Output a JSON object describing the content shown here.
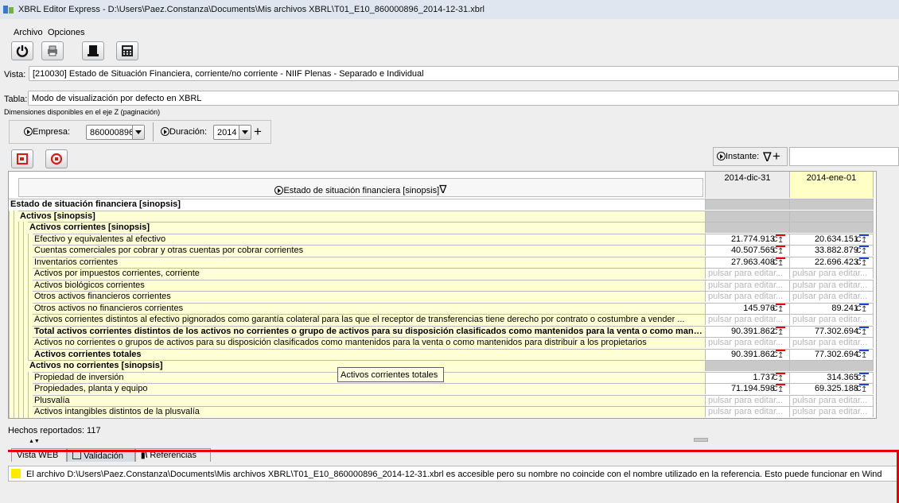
{
  "window": {
    "title": "XBRL Editor Express - D:\\Users\\Paez.Constanza\\Documents\\Mis archivos XBRL\\T01_E10_860000896_2014-12-31.xbrl"
  },
  "menu": {
    "archivo": "Archivo",
    "opciones": "Opciones"
  },
  "vista": {
    "label": "Vista:",
    "value": "[210030] Estado de Situación Financiera, corriente/no corriente - NIIF Plenas - Separado e Individual"
  },
  "tabla": {
    "label": "Tabla:",
    "value": "Modo de visualización por defecto en XBRL"
  },
  "dimensions": {
    "heading": "Dimensiones disponibles en el eje Z (paginación)",
    "empresa_label": "Empresa:",
    "empresa_value": "860000896",
    "duracion_label": "Duración:",
    "duracion_value": "2014"
  },
  "table": {
    "axis_label": "Estado de situación financiera [sinopsis]",
    "instante_label": "Instante:",
    "col1": "2014-dic-31",
    "col2": "2014-ene-01",
    "placeholder": "pulsar para editar...",
    "rows": [
      {
        "label": "Estado de situación financiera [sinopsis]",
        "v1": "",
        "v2": ""
      },
      {
        "label": "Activos [sinopsis]",
        "v1": "",
        "v2": ""
      },
      {
        "label": "Activos corrientes [sinopsis]",
        "v1": "",
        "v2": ""
      },
      {
        "label": "Efectivo y equivalentes al efectivo",
        "v1": "21.774.913",
        "v2": "20.634.151"
      },
      {
        "label": "Cuentas comerciales por cobrar y otras cuentas por cobrar corrientes",
        "v1": "40.507.565",
        "v2": "33.882.879"
      },
      {
        "label": "Inventarios corrientes",
        "v1": "27.963.408",
        "v2": "22.696.423"
      },
      {
        "label": "Activos por impuestos corrientes, corriente",
        "v1": "",
        "v2": ""
      },
      {
        "label": "Activos biológicos corrientes",
        "v1": "",
        "v2": ""
      },
      {
        "label": "Otros activos financieros corrientes",
        "v1": "",
        "v2": ""
      },
      {
        "label": "Otros activos no financieros corrientes",
        "v1": "145.976",
        "v2": "89.241"
      },
      {
        "label": "Activos corrientes distintos al efectivo pignorados como garantía colateral para las que el receptor de transferencias tiene derecho por contrato o costumbre a vender ...",
        "v1": "",
        "v2": ""
      },
      {
        "label": "Total activos corrientes distintos de los activos no corrientes o grupo de activos para su disposición clasificados como mantenidos para la venta o como mante...",
        "v1": "90.391.862",
        "v2": "77.302.694"
      },
      {
        "label": "Activos no corrientes o grupos de activos para su disposición clasificados como mantenidos para la venta o como mantenidos para distribuir a los propietarios",
        "v1": "",
        "v2": ""
      },
      {
        "label": "Activos corrientes totales",
        "v1": "90.391.862",
        "v2": "77.302.694"
      },
      {
        "label": "Activos no corrientes [sinopsis]",
        "v1": "",
        "v2": ""
      },
      {
        "label": "Propiedad de inversión",
        "v1": "1.737",
        "v2": "314.365"
      },
      {
        "label": "Propiedades, planta y equipo",
        "v1": "71.194.598",
        "v2": "69.325.188"
      },
      {
        "label": "Plusvalía",
        "v1": "",
        "v2": ""
      },
      {
        "label": "Activos intangibles distintos de la plusvalía",
        "v1": "",
        "v2": ""
      }
    ]
  },
  "tooltip": "Activos corrientes totales",
  "status": "Hechos reportados: 117",
  "tabs": [
    "Vista WEB",
    "Validación",
    "Referencias"
  ],
  "message": "El archivo D:\\Users\\Paez.Constanza\\Documents\\Mis archivos XBRL\\T01_E10_860000896_2014-12-31.xbrl es accesible pero su nombre no coincide con el nombre utilizado en la referencia. Esto puede funcionar en Wind",
  "colors": {
    "yellow_row": "#ffffd5",
    "gray": "#c9c9c9",
    "red_mark": "#e8000b",
    "blue_mark": "#1a44d6",
    "highlight": "#ffea00"
  }
}
